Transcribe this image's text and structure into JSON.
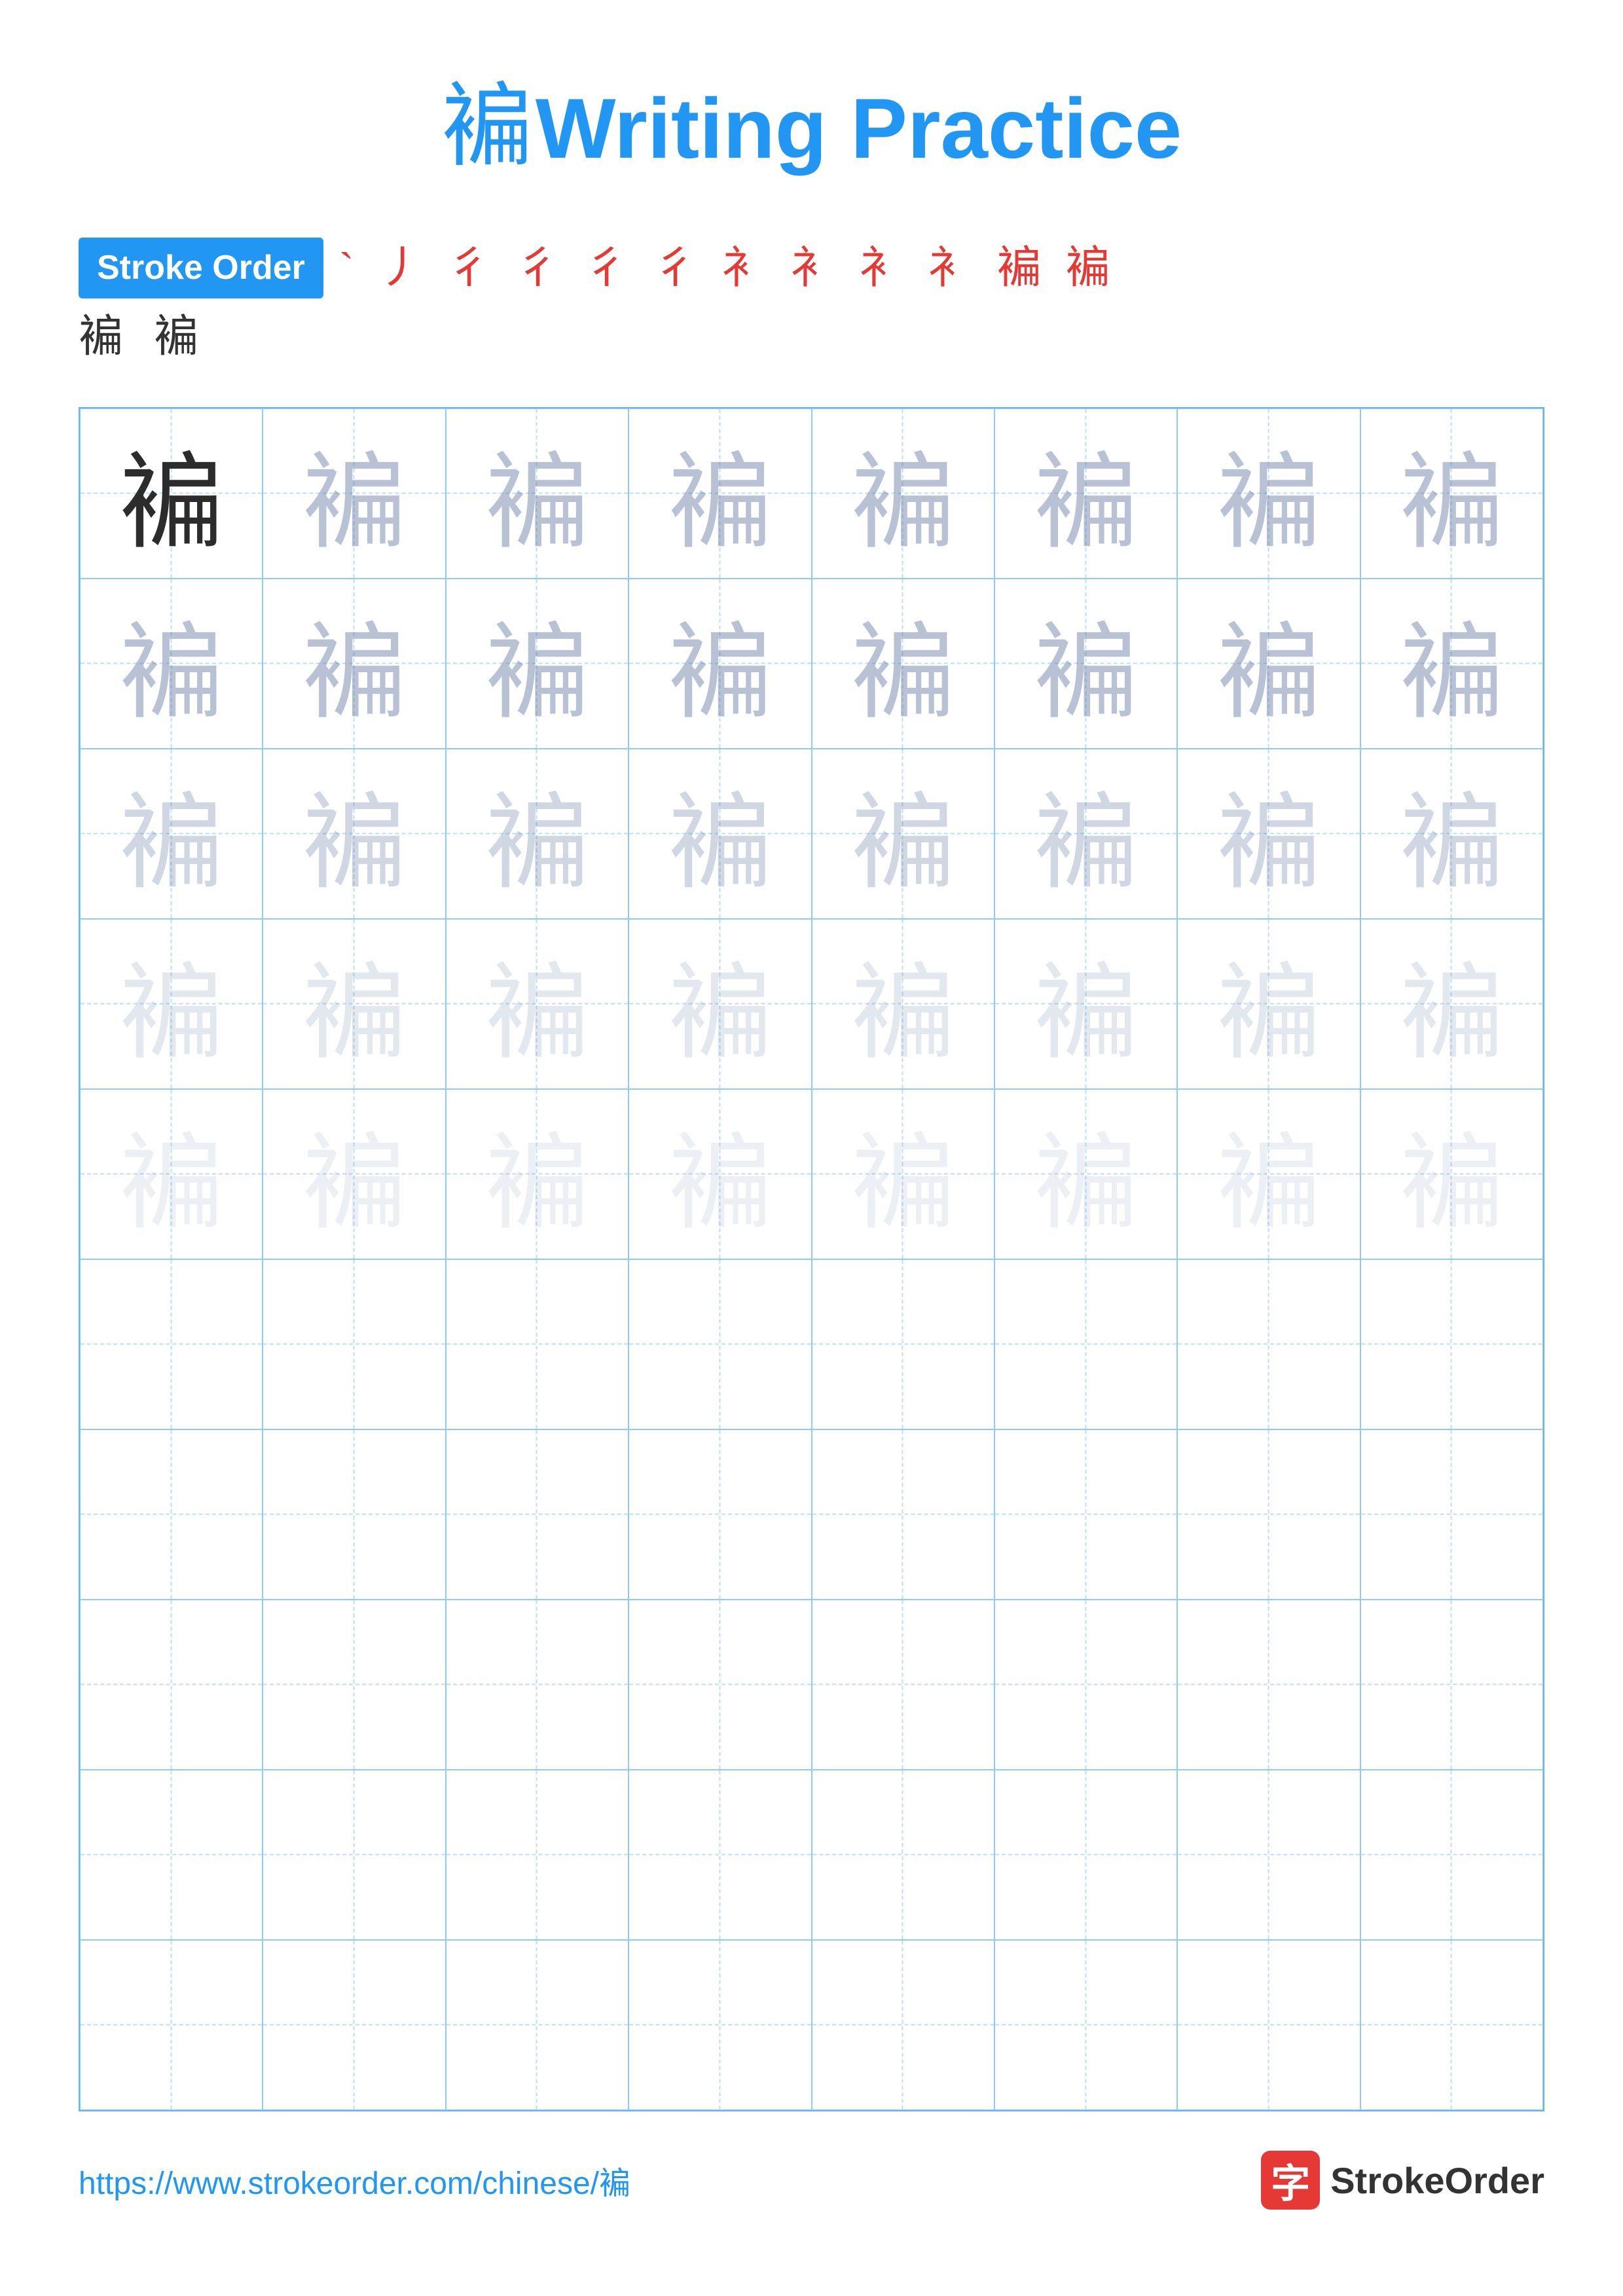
{
  "title": {
    "char": "褊",
    "label": "Writing Practice"
  },
  "stroke_order": {
    "badge_label": "Stroke Order",
    "strokes": "` 丿 彳 彳 彳 彳 衤 衤 衤 衤 褊 褊",
    "extra": "褊 褊"
  },
  "character": "褊",
  "grid": {
    "rows": 10,
    "cols": 8,
    "guide_rows": 5
  },
  "footer": {
    "url": "https://www.strokeorder.com/chinese/褊",
    "logo_char": "字",
    "logo_text": "StrokeOrder"
  }
}
